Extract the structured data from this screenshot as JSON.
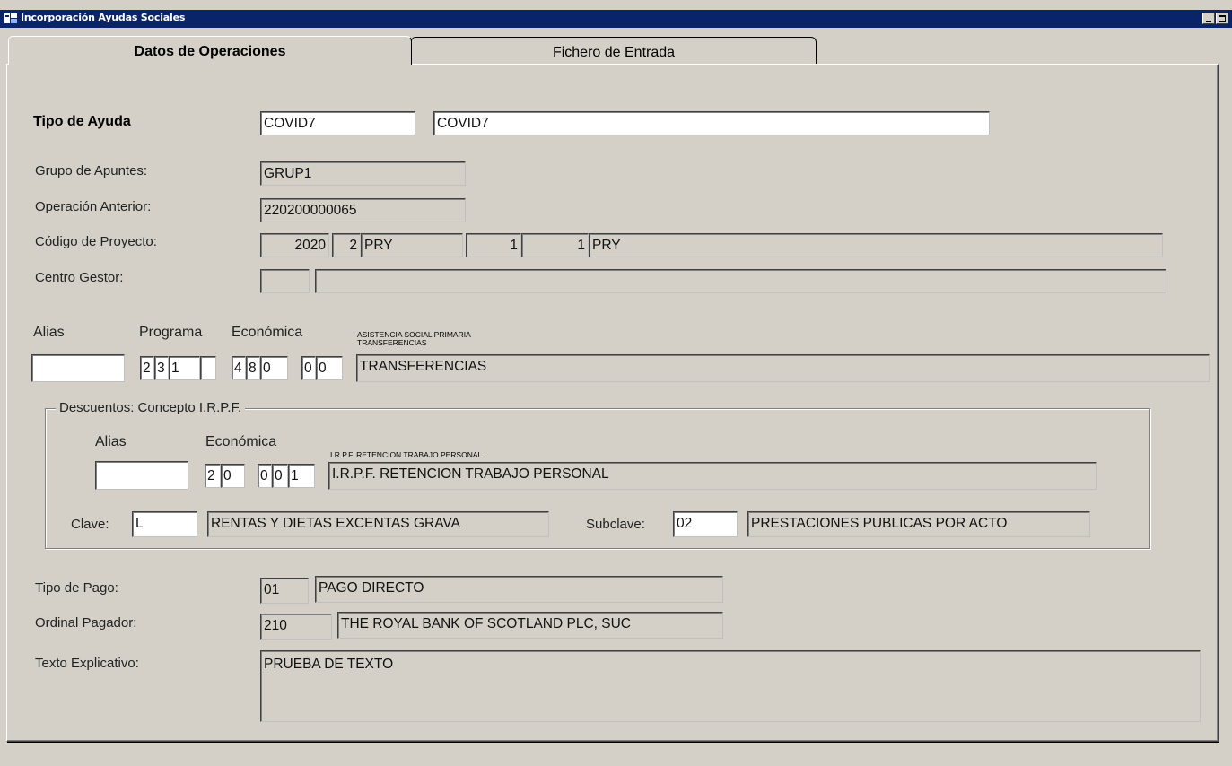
{
  "window": {
    "title": "Incorporación Ayudas Sociales",
    "icon": "app-icon",
    "controls": [
      "minimize-icon",
      "maximize-icon"
    ]
  },
  "tabs": [
    {
      "label": "Datos de Operaciones",
      "active": true
    },
    {
      "label": "Fichero de Entrada",
      "active": false
    }
  ],
  "tipo_ayuda": {
    "label": "Tipo de Ayuda",
    "code": "COVID7",
    "description": "COVID7"
  },
  "grupo_apuntes": {
    "label": "Grupo de Apuntes:",
    "value": "GRUP1"
  },
  "operacion_anterior": {
    "label": "Operación Anterior:",
    "value": "220200000065"
  },
  "codigo_proyecto": {
    "label": "Código de Proyecto:",
    "year": "2020",
    "num": "2",
    "code1": "PRY",
    "blank": "",
    "sub1": "1",
    "sub2": "1",
    "code2": "PRY"
  },
  "centro_gestor": {
    "label": "Centro Gestor:",
    "code": "",
    "description": ""
  },
  "aplicacion": {
    "alias_label": "Alias",
    "programa_label": "Programa",
    "economica_label": "Económica",
    "hint_line1": "ASISTENCIA SOCIAL PRIMARIA",
    "hint_line2": "TRANSFERENCIAS",
    "alias_value": "",
    "programa_digits": [
      "2",
      "3",
      "1",
      ""
    ],
    "economica_digits": [
      "4",
      "8",
      "0"
    ],
    "sub_digits": [
      "0",
      "0"
    ],
    "description": "TRANSFERENCIAS"
  },
  "descuentos": {
    "group_title": "Descuentos: Concepto I.R.P.F.",
    "alias_label": "Alias",
    "economica_label": "Económica",
    "hint": "I.R.P.F. RETENCION TRABAJO PERSONAL",
    "alias_value": "",
    "eco_digits_a": [
      "2",
      "0"
    ],
    "eco_digits_b": [
      "0",
      "0",
      "1"
    ],
    "description": "I.R.P.F. RETENCION TRABAJO PERSONAL",
    "clave_label": "Clave:",
    "clave_value": "L",
    "clave_description": "RENTAS Y DIETAS EXCENTAS GRAVA",
    "subclave_label": "Subclave:",
    "subclave_value": "02",
    "subclave_description": "PRESTACIONES PUBLICAS POR ACTO"
  },
  "tipo_pago": {
    "label": "Tipo de Pago:",
    "code": "01",
    "description": "PAGO DIRECTO"
  },
  "ordinal_pagador": {
    "label": "Ordinal Pagador:",
    "code": "210",
    "description": "THE ROYAL BANK OF SCOTLAND PLC, SUC"
  },
  "texto_explicativo": {
    "label": "Texto Explicativo:",
    "value": "PRUEBA DE TEXTO"
  }
}
